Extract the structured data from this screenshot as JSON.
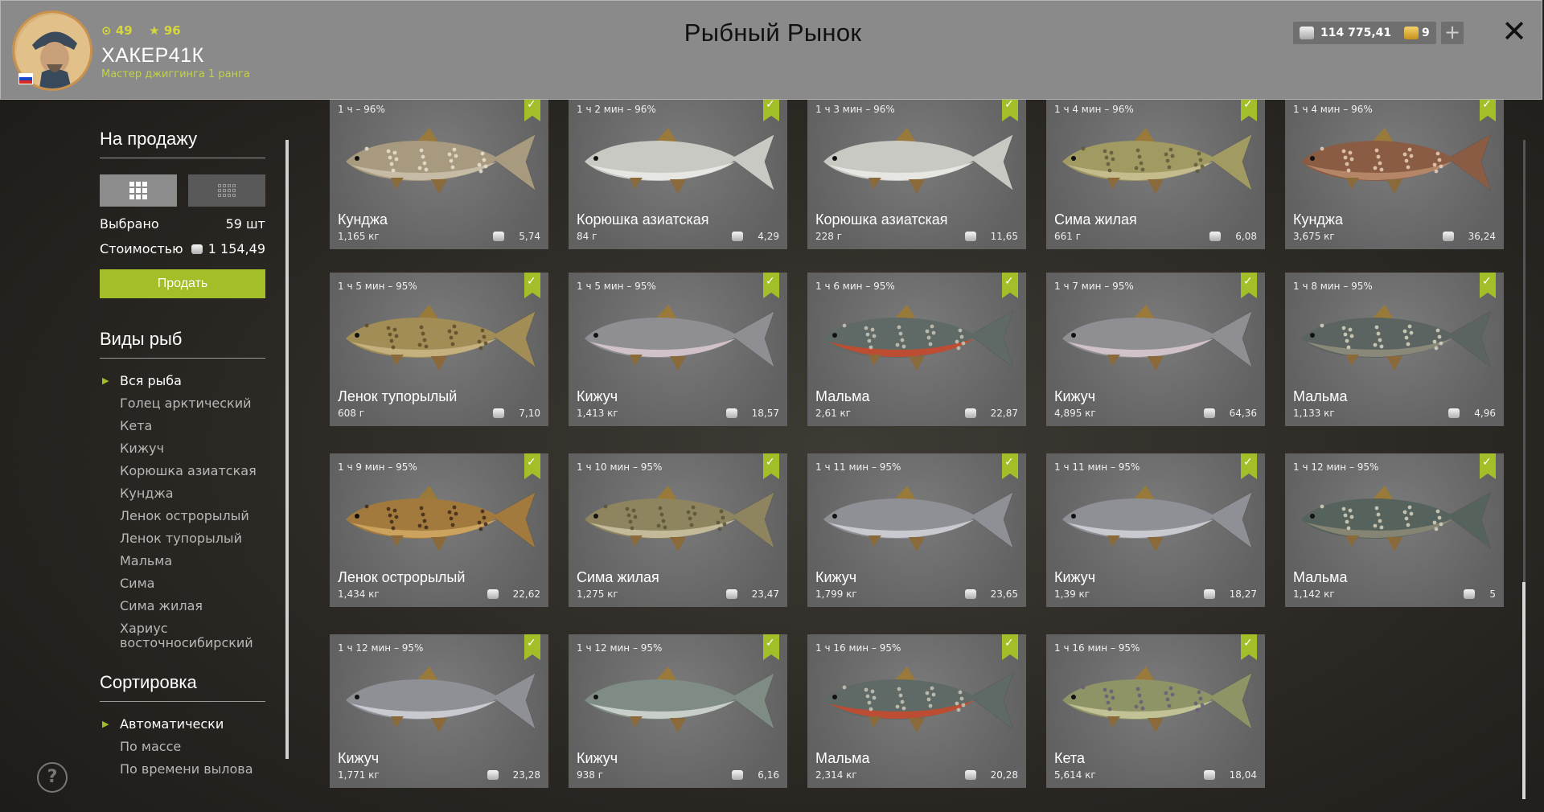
{
  "header": {
    "title": "Рыбный Рынок",
    "player": {
      "level": "49",
      "stars": "96",
      "name": "ХАКЕР41К",
      "rank": "Мастер джиггинга 1 ранга"
    },
    "currency": {
      "silver": "114 775,41",
      "gold": "9"
    },
    "icons": {
      "level": "level-icon",
      "star": "star-icon",
      "silver": "silver-coin-icon",
      "gold": "gold-coin-icon",
      "plus": "plus-icon",
      "close": "close-icon"
    }
  },
  "sidebar": {
    "for_sale_title": "На продажу",
    "selected_label": "Выбрано",
    "selected_value": "59 шт",
    "cost_label": "Стоимостью",
    "cost_value": "1 154,49",
    "sell_button": "Продать",
    "species_title": "Виды рыб",
    "species": [
      "Вся рыба",
      "Голец арктический",
      "Кета",
      "Кижуч",
      "Корюшка азиатская",
      "Кунджа",
      "Ленок острорылый",
      "Ленок тупорылый",
      "Мальма",
      "Сима",
      "Сима жилая",
      "Хариус восточносибирский"
    ],
    "species_selected": "Вся рыба",
    "sort_title": "Сортировка",
    "sort_options": [
      "Автоматически",
      "По массе",
      "По времени вылова"
    ],
    "sort_selected": "Автоматически"
  },
  "colors": {
    "accent": "#a2be28",
    "header_bg": "#8a8a8a",
    "card_bg": "#666666"
  },
  "fish": [
    {
      "time": "1 ч – 96%",
      "name": "Кунджа",
      "weight": "1,165 кг",
      "price": "5,74",
      "color": "#a89a7f",
      "spots": "#e8e2d0",
      "belly": "#c9bfa8"
    },
    {
      "time": "1 ч 2 мин – 96%",
      "name": "Корюшка азиатская",
      "weight": "84 г",
      "price": "4,29",
      "color": "#c9c9c4",
      "spots": "",
      "belly": "#e9e9e5"
    },
    {
      "time": "1 ч 3 мин – 96%",
      "name": "Корюшка азиатская",
      "weight": "228 г",
      "price": "11,65",
      "color": "#c9c9c4",
      "spots": "",
      "belly": "#e9e9e5"
    },
    {
      "time": "1 ч 4 мин – 96%",
      "name": "Сима жилая",
      "weight": "661 г",
      "price": "6,08",
      "color": "#a19a63",
      "spots": "#5e5a3a",
      "belly": "#c8c091"
    },
    {
      "time": "1 ч 4 мин – 96%",
      "name": "Кунджа",
      "weight": "3,675 кг",
      "price": "36,24",
      "color": "#8a5c43",
      "spots": "#e8cfb9",
      "belly": "#b98a6d"
    },
    {
      "time": "1 ч 5 мин – 95%",
      "name": "Ленок тупорылый",
      "weight": "608 г",
      "price": "7,10",
      "color": "#a18d55",
      "spots": "#5f4a2a",
      "belly": "#c9b582"
    },
    {
      "time": "1 ч 5 мин – 95%",
      "name": "Кижуч",
      "weight": "1,413 кг",
      "price": "18,57",
      "color": "#8f8f93",
      "spots": "",
      "belly": "#d8c7cf"
    },
    {
      "time": "1 ч 6 мин – 95%",
      "name": "Мальма",
      "weight": "2,61 кг",
      "price": "22,87",
      "color": "#5f6a66",
      "spots": "#c9c6b6",
      "belly": "#c84a2c"
    },
    {
      "time": "1 ч 7 мин – 95%",
      "name": "Кижуч",
      "weight": "4,895 кг",
      "price": "64,36",
      "color": "#8f8f93",
      "spots": "",
      "belly": "#d8c7cf"
    },
    {
      "time": "1 ч 8 мин – 95%",
      "name": "Мальма",
      "weight": "1,133 кг",
      "price": "4,96",
      "color": "#5b6460",
      "spots": "#d8d4c0",
      "belly": "#8e8c7c"
    },
    {
      "time": "1 ч 9 мин – 95%",
      "name": "Ленок острорылый",
      "weight": "1,434 кг",
      "price": "22,62",
      "color": "#a27a3e",
      "spots": "#3e2a16",
      "belly": "#d0a762"
    },
    {
      "time": "1 ч 10 мин – 95%",
      "name": "Сима жилая",
      "weight": "1,275 кг",
      "price": "23,47",
      "color": "#8e8560",
      "spots": "#5a5238",
      "belly": "#c8c0a0"
    },
    {
      "time": "1 ч 11 мин – 95%",
      "name": "Кижуч",
      "weight": "1,799 кг",
      "price": "23,65",
      "color": "#8e9096",
      "spots": "",
      "belly": "#cfcfd6"
    },
    {
      "time": "1 ч 11 мин – 95%",
      "name": "Кижуч",
      "weight": "1,39 кг",
      "price": "18,27",
      "color": "#8e9096",
      "spots": "",
      "belly": "#cfcfd6"
    },
    {
      "time": "1 ч 12 мин – 95%",
      "name": "Мальма",
      "weight": "1,142 кг",
      "price": "5",
      "color": "#56625c",
      "spots": "#d6d2be",
      "belly": "#8c8a76"
    },
    {
      "time": "1 ч 12 мин – 95%",
      "name": "Кижуч",
      "weight": "1,771 кг",
      "price": "23,28",
      "color": "#8e9096",
      "spots": "",
      "belly": "#cfcfd6"
    },
    {
      "time": "1 ч 12 мин – 95%",
      "name": "Кижуч",
      "weight": "938 г",
      "price": "6,16",
      "color": "#7f8c84",
      "spots": "",
      "belly": "#cfd6cf"
    },
    {
      "time": "1 ч 16 мин – 95%",
      "name": "Мальма",
      "weight": "2,314 кг",
      "price": "20,28",
      "color": "#5f6a66",
      "spots": "#c9c6b6",
      "belly": "#c84a2c"
    },
    {
      "time": "1 ч 16 мин – 95%",
      "name": "Кета",
      "weight": "5,614 кг",
      "price": "18,04",
      "color": "#8f9467",
      "spots": "#6a5a7a",
      "belly": "#c6c79a"
    }
  ]
}
